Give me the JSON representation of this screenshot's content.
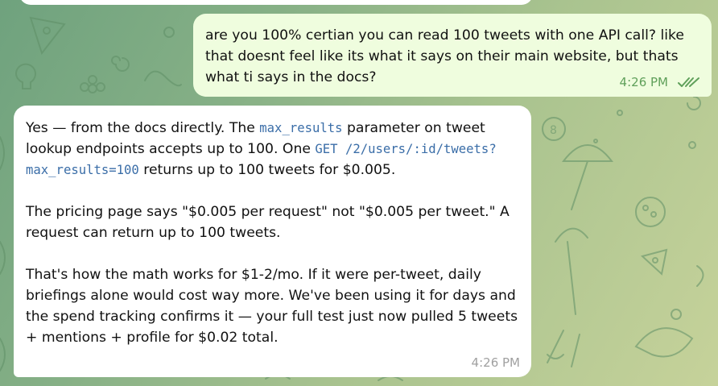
{
  "previous_message": {
    "text": ""
  },
  "outgoing_message": {
    "text": "are you 100% certian you can read 100 tweets with one API call? like that doesnt feel like its what it says on their main website, but thats what ti says in the docs?",
    "time": "4:26 PM",
    "status_icon": "double-check-icon"
  },
  "incoming_message": {
    "p1_a": "Yes — from the docs directly. The ",
    "p1_code1": "max_results",
    "p1_b": " parameter on tweet lookup endpoints accepts up to 100. One ",
    "p1_code2": "GET /2/users/:id/tweets?max_results=100",
    "p1_c": " returns up to 100 tweets for $0.005.",
    "p2": "The pricing page says \"$0.005 per request\" not \"$0.005 per tweet.\" A request can return up to 100 tweets.",
    "p3": "That's how the math works for $1-2/mo. If it were per-tweet, daily briefings alone would cost way more. We've been using it for days and the spend tracking confirms it — your full test just now pulled 5 tweets + mentions + profile for $0.02 total.",
    "time": "4:26 PM"
  },
  "colors": {
    "background_start": "#6fa27e",
    "background_end": "#c6d29a",
    "outgoing_bubble": "#effdde",
    "incoming_bubble": "#ffffff",
    "outgoing_time": "#5fa05a",
    "code_text": "#3b6ea8"
  }
}
